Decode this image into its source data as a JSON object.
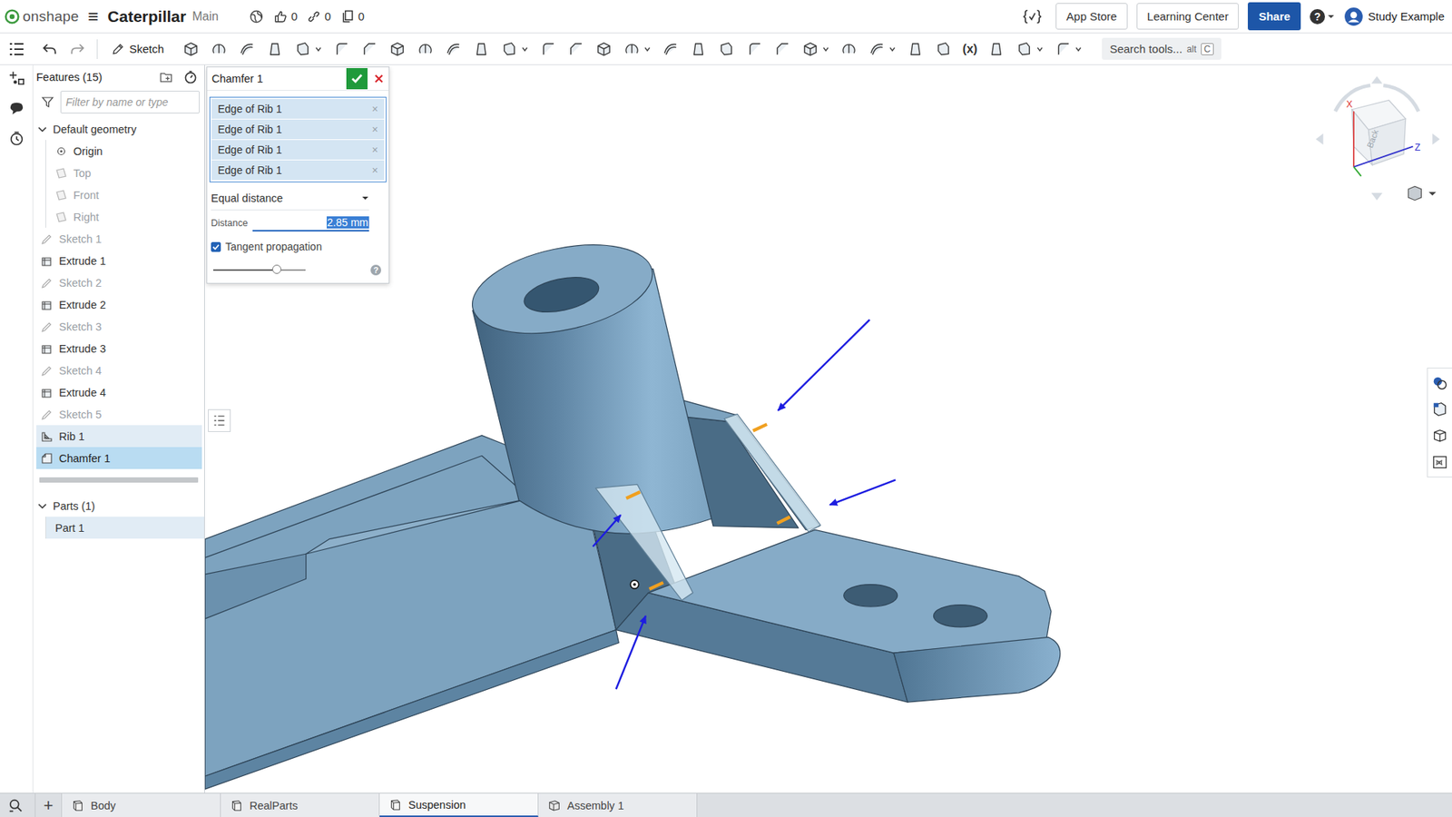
{
  "app": {
    "logo": "onshape",
    "menu": "≡",
    "document": "Caterpillar",
    "branch": "Main",
    "likes": "0",
    "links": "0",
    "copies": "0"
  },
  "topbar_right": {
    "buttons": [
      "App Store",
      "Learning Center"
    ],
    "share": "Share",
    "help": "?",
    "user": "Study Example"
  },
  "toolbar": {
    "sketch": "Sketch",
    "variable": "(x)",
    "search": "Search tools...",
    "shortcut_prefix": "alt",
    "shortcut_key": "C"
  },
  "features": {
    "title": "Features (15)",
    "filter_placeholder": "Filter by name or type",
    "default_geometry": {
      "label": "Default geometry",
      "expanded": true,
      "items": [
        {
          "label": "Origin",
          "kind": "origin",
          "disabled": false
        },
        {
          "label": "Top",
          "kind": "plane",
          "disabled": true
        },
        {
          "label": "Front",
          "kind": "plane",
          "disabled": true
        },
        {
          "label": "Right",
          "kind": "plane",
          "disabled": true
        }
      ]
    },
    "items": [
      {
        "label": "Sketch 1",
        "kind": "sketch",
        "disabled": true,
        "selected": false,
        "highlighted": false
      },
      {
        "label": "Extrude 1",
        "kind": "extrude",
        "disabled": false,
        "selected": false,
        "highlighted": false
      },
      {
        "label": "Sketch 2",
        "kind": "sketch",
        "disabled": true,
        "selected": false,
        "highlighted": false
      },
      {
        "label": "Extrude 2",
        "kind": "extrude",
        "disabled": false,
        "selected": false,
        "highlighted": false
      },
      {
        "label": "Sketch 3",
        "kind": "sketch",
        "disabled": true,
        "selected": false,
        "highlighted": false
      },
      {
        "label": "Extrude 3",
        "kind": "extrude",
        "disabled": false,
        "selected": false,
        "highlighted": false
      },
      {
        "label": "Sketch 4",
        "kind": "sketch",
        "disabled": true,
        "selected": false,
        "highlighted": false
      },
      {
        "label": "Extrude 4",
        "kind": "extrude",
        "disabled": false,
        "selected": false,
        "highlighted": false
      },
      {
        "label": "Sketch 5",
        "kind": "sketch",
        "disabled": true,
        "selected": false,
        "highlighted": false
      },
      {
        "label": "Rib 1",
        "kind": "rib",
        "disabled": false,
        "selected": false,
        "highlighted": true
      },
      {
        "label": "Chamfer 1",
        "kind": "chamfer",
        "disabled": false,
        "selected": true,
        "highlighted": false
      }
    ],
    "parts": {
      "label": "Parts (1)",
      "expanded": true,
      "items": [
        {
          "label": "Part 1",
          "selected": false,
          "highlighted": true
        }
      ]
    }
  },
  "dialog": {
    "title": "Chamfer 1",
    "selections": [
      {
        "label": "Edge of Rib 1",
        "remove": "×"
      },
      {
        "label": "Edge of Rib 1",
        "remove": "×"
      },
      {
        "label": "Edge of Rib 1",
        "remove": "×"
      },
      {
        "label": "Edge of Rib 1",
        "remove": "×"
      }
    ],
    "type": "Equal distance",
    "distance_label": "Distance",
    "distance": "2.85 mm",
    "distance_selected": true,
    "tangent": {
      "label": "Tangent propagation",
      "checked": true
    },
    "slider": {
      "level": 0.69
    },
    "help": "?"
  },
  "viewcube": {
    "face": "Back",
    "x_axis": "X",
    "z_axis": "Z"
  },
  "tabs": {
    "add": "+",
    "items": [
      {
        "label": "Body",
        "kind": "partstudio",
        "selected": false
      },
      {
        "label": "RealParts",
        "kind": "partstudio",
        "selected": false
      },
      {
        "label": "Suspension",
        "kind": "partstudio",
        "selected": true
      },
      {
        "label": "Assembly 1",
        "kind": "assembly",
        "selected": false
      }
    ]
  }
}
